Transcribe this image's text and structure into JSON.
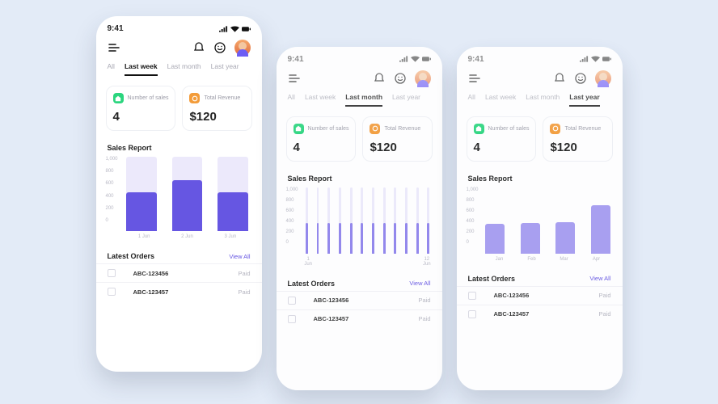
{
  "colors": {
    "accent": "#6656e2",
    "green": "#2bd57e",
    "orange": "#f39c3a",
    "bg": "#e3ebf7"
  },
  "status": {
    "time": "9:41"
  },
  "screens": [
    {
      "id": "week",
      "tabs": [
        "All",
        "Last week",
        "Last month",
        "Last year"
      ],
      "active_tab": 1,
      "cards": [
        {
          "icon": "tag-icon",
          "color": "green",
          "label": "Number of sales",
          "value": "4"
        },
        {
          "icon": "revenue-icon",
          "color": "orange",
          "label": "Total Revenue",
          "value": "$120"
        }
      ],
      "sales_title": "Sales Report",
      "orders_title": "Latest Orders",
      "view_all": "View All",
      "orders": [
        {
          "id": "ABC-123456",
          "status": "Paid"
        },
        {
          "id": "ABC-123457",
          "status": "Paid"
        }
      ]
    },
    {
      "id": "month",
      "tabs": [
        "All",
        "Last week",
        "Last month",
        "Last year"
      ],
      "active_tab": 2,
      "cards": [
        {
          "icon": "tag-icon",
          "color": "green",
          "label": "Number of sales",
          "value": "4"
        },
        {
          "icon": "revenue-icon",
          "color": "orange",
          "label": "Total Revenue",
          "value": "$120"
        }
      ],
      "sales_title": "Sales Report",
      "orders_title": "Latest Orders",
      "view_all": "View All",
      "orders": [
        {
          "id": "ABC-123456",
          "status": "Paid"
        },
        {
          "id": "ABC-123457",
          "status": "Paid"
        }
      ]
    },
    {
      "id": "year",
      "tabs": [
        "All",
        "Last week",
        "Last month",
        "Last year"
      ],
      "active_tab": 3,
      "cards": [
        {
          "icon": "tag-icon",
          "color": "green",
          "label": "Number of sales",
          "value": "4"
        },
        {
          "icon": "revenue-icon",
          "color": "orange",
          "label": "Total Revenue",
          "value": "$120"
        }
      ],
      "sales_title": "Sales Report",
      "orders_title": "Latest Orders",
      "view_all": "View All",
      "orders": [
        {
          "id": "ABC-123456",
          "status": "Paid"
        },
        {
          "id": "ABC-123457",
          "status": "Paid"
        }
      ]
    }
  ],
  "chart_data": [
    {
      "screen": "week",
      "type": "bar",
      "title": "Sales Report",
      "ylabel": "",
      "xlabel": "",
      "ylim": [
        0,
        1000
      ],
      "yticks": [
        "1,000",
        "800",
        "600",
        "400",
        "200",
        "0"
      ],
      "categories": [
        "1 Jun",
        "2 Jun",
        "3 Jun"
      ],
      "series": [
        {
          "name": "background",
          "values": [
            1000,
            1000,
            1000
          ]
        },
        {
          "name": "sales",
          "values": [
            520,
            680,
            520
          ]
        }
      ]
    },
    {
      "screen": "month",
      "type": "bar",
      "title": "Sales Report",
      "ylim": [
        0,
        1000
      ],
      "yticks": [
        "1,000",
        "800",
        "600",
        "400",
        "200",
        "0"
      ],
      "categories": [
        "1 Jun",
        "",
        "",
        "",
        "",
        "",
        "",
        "",
        "",
        "",
        "",
        "12 Jun"
      ],
      "series": [
        {
          "name": "background",
          "values": [
            1000,
            1000,
            1000,
            1000,
            1000,
            1000,
            1000,
            1000,
            1000,
            1000,
            1000,
            1000
          ]
        },
        {
          "name": "sales",
          "values": [
            460,
            460,
            460,
            460,
            460,
            460,
            460,
            460,
            460,
            460,
            460,
            460
          ]
        }
      ]
    },
    {
      "screen": "year",
      "type": "bar",
      "title": "Sales Report",
      "ylim": [
        0,
        1000
      ],
      "yticks": [
        "1,000",
        "800",
        "600",
        "400",
        "200",
        "0"
      ],
      "categories": [
        "Jan",
        "Feb",
        "Mar",
        "Apr"
      ],
      "series": [
        {
          "name": "sales",
          "values": [
            450,
            460,
            470,
            730
          ]
        }
      ]
    }
  ]
}
